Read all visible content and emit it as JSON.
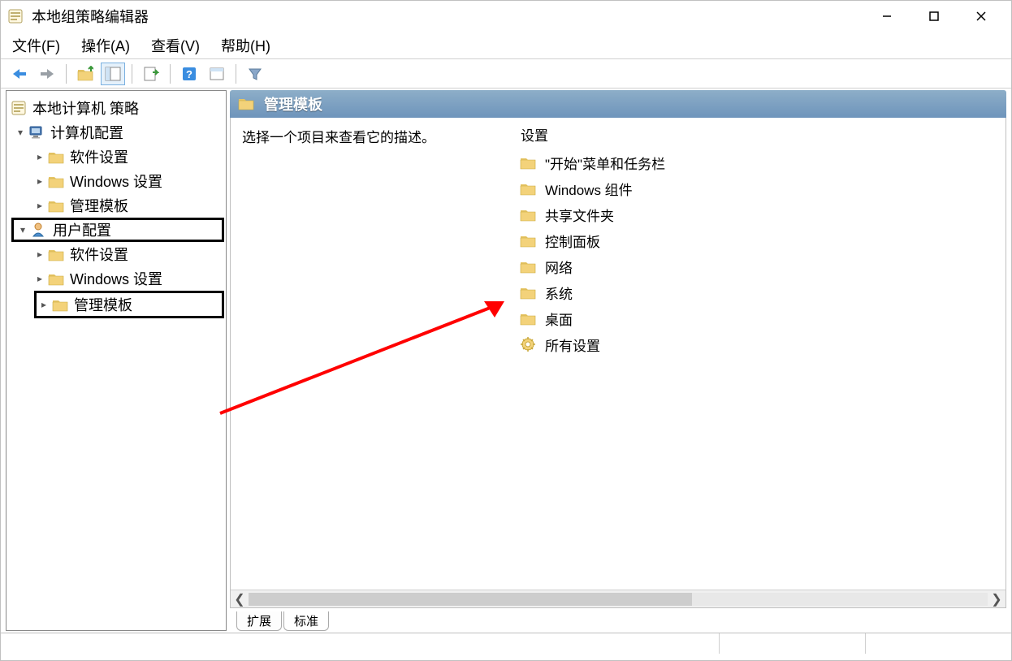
{
  "window": {
    "title": "本地组策略编辑器"
  },
  "menu": {
    "file": "文件(F)",
    "action": "操作(A)",
    "view": "查看(V)",
    "help": "帮助(H)"
  },
  "tree": {
    "root": "本地计算机 策略",
    "computer_config": "计算机配置",
    "software_settings_1": "软件设置",
    "windows_settings_1": "Windows 设置",
    "admin_templates_1": "管理模板",
    "user_config": "用户配置",
    "software_settings_2": "软件设置",
    "windows_settings_2": "Windows 设置",
    "admin_templates_2": "管理模板"
  },
  "right": {
    "header": "管理模板",
    "description": "选择一个项目来查看它的描述。",
    "settings_header": "设置",
    "items": [
      "\"开始\"菜单和任务栏",
      "Windows 组件",
      "共享文件夹",
      "控制面板",
      "网络",
      "系统",
      "桌面",
      "所有设置"
    ]
  },
  "tabs": {
    "extended": "扩展",
    "standard": "标准"
  }
}
